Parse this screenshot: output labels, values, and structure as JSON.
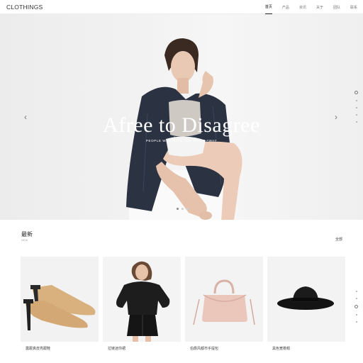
{
  "header": {
    "brand": "CLOTHINGS",
    "nav": [
      "首页",
      "产品",
      "资讯",
      "关于",
      "团队",
      "联系"
    ]
  },
  "hero": {
    "title": "Afree to Disagree",
    "subtitle": "PEOPLE WHO HATE THE NIGHT AWAY",
    "prev_icon": "chevron-left-icon",
    "next_icon": "chevron-right-icon"
  },
  "latest": {
    "title": "最新",
    "subtitle": "NEW",
    "all_label": "全部"
  },
  "products": [
    {
      "name": "露跟真皮亮跟鞋",
      "icon": "mule-shoe-image"
    },
    {
      "name": "拉链迷你裙",
      "icon": "model-skirt-image"
    },
    {
      "name": "伯爵风都市手提包",
      "icon": "handbag-image"
    },
    {
      "name": "黑色宽檐帽",
      "icon": "fedora-hat-image"
    }
  ],
  "colors": {
    "accent": "#222222",
    "hero_bg": "#f0f0f0",
    "card_bg": "#f3f3f3"
  }
}
